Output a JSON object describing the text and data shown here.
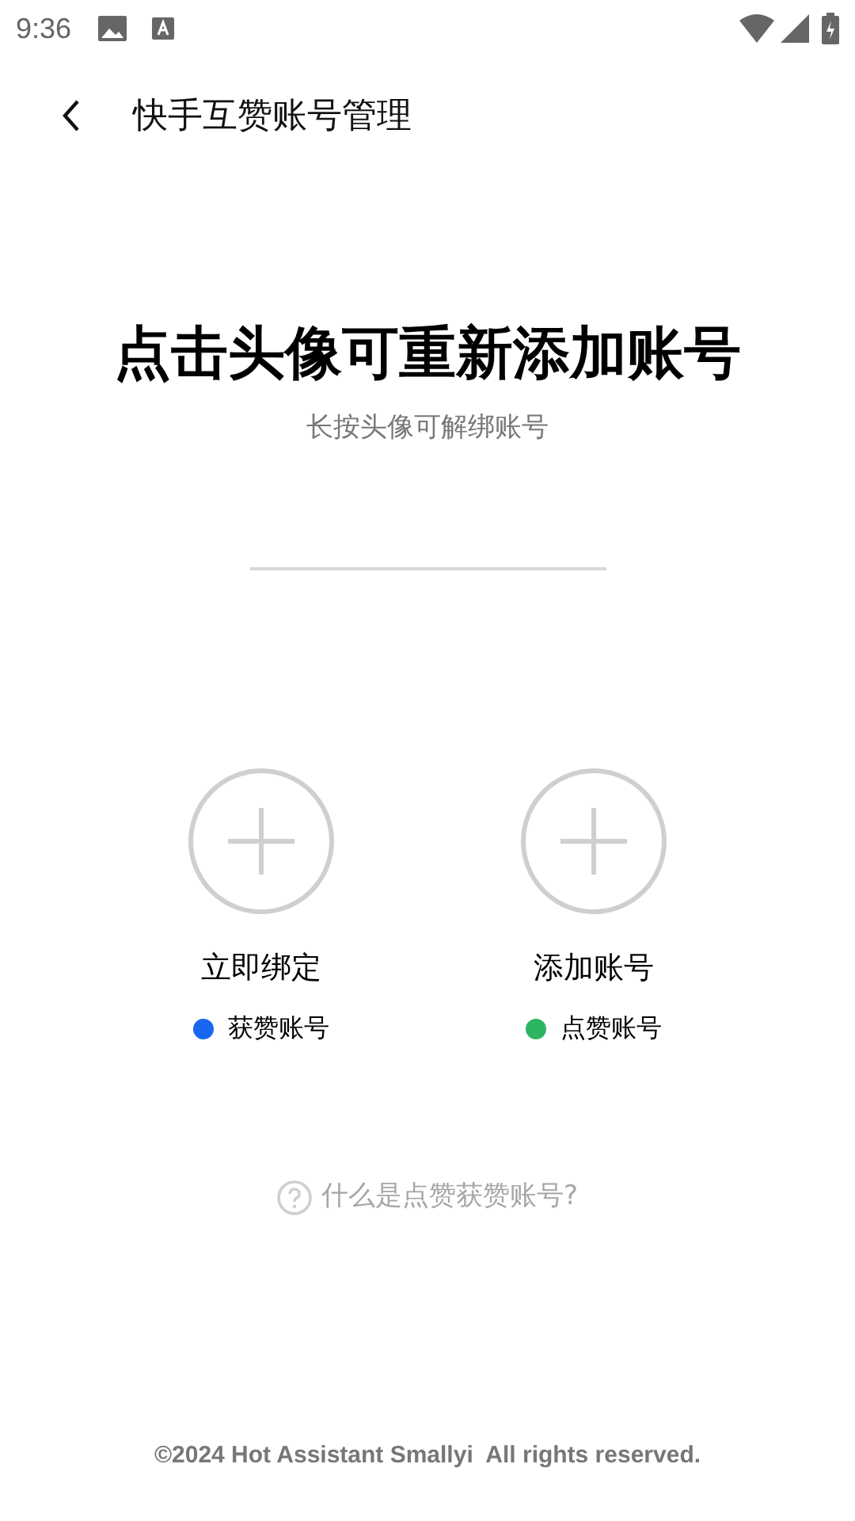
{
  "status_bar": {
    "time": "9:36"
  },
  "header": {
    "title": "快手互赞账号管理"
  },
  "heading": "点击头像可重新添加账号",
  "subheading": "长按头像可解绑账号",
  "accounts": [
    {
      "label": "立即绑定",
      "tag": "获赞账号",
      "color": "#1a66f0"
    },
    {
      "label": "添加账号",
      "tag": "点赞账号",
      "color": "#2eb562"
    }
  ],
  "help_link": "什么是点赞获赞账号?",
  "footer": "©2024 Hot Assistant Smallyi  All rights reserved."
}
